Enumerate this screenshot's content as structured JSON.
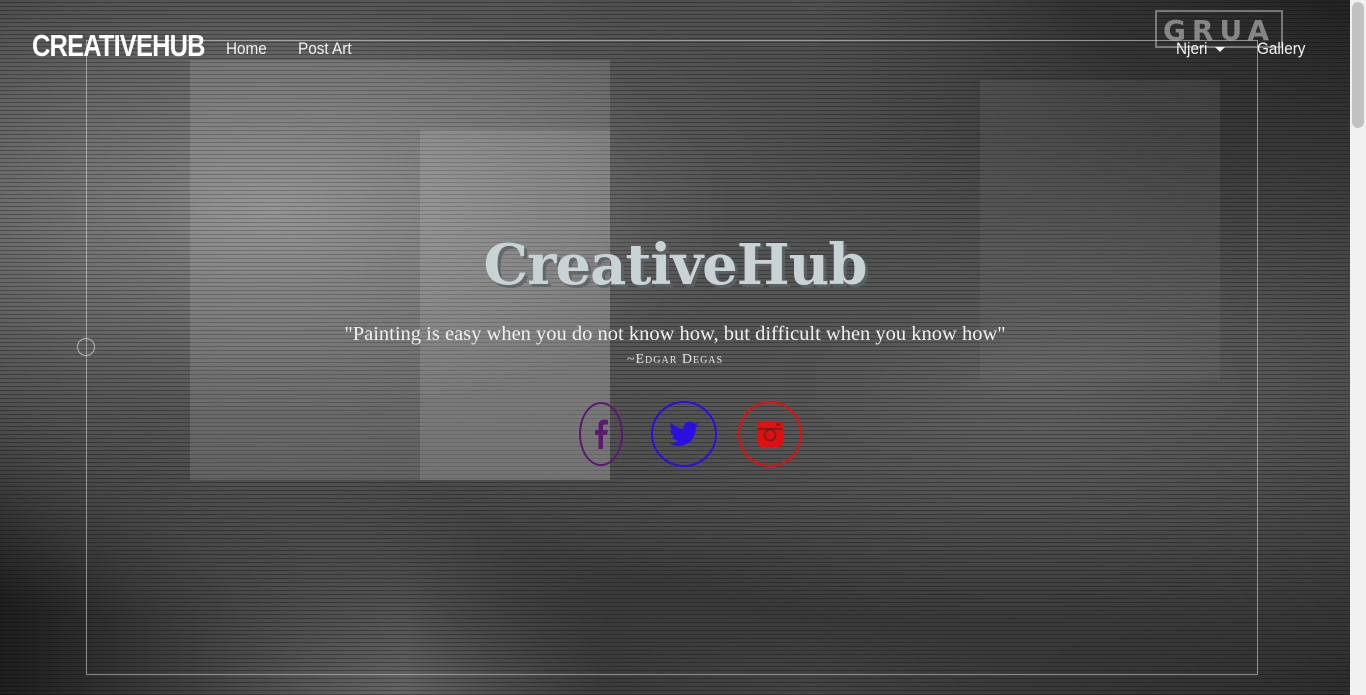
{
  "navbar": {
    "brand": "CREATIVEHUB",
    "links": [
      "Home",
      "Post Art"
    ],
    "user_dropdown": "Njeri",
    "gallery": "Gallery"
  },
  "hero": {
    "title": "CreativeHub",
    "quote": "\"Painting is easy when you do not know how, but difficult when you know how\"",
    "author": "~Edgar Degas",
    "background_sign": "GRUA"
  },
  "social": [
    {
      "name": "facebook",
      "icon": "facebook-icon",
      "color": "#5b1a6e"
    },
    {
      "name": "twitter",
      "icon": "twitter-icon",
      "color": "#2a0fe0"
    },
    {
      "name": "instagram",
      "icon": "instagram-icon",
      "color": "#e01010"
    }
  ]
}
